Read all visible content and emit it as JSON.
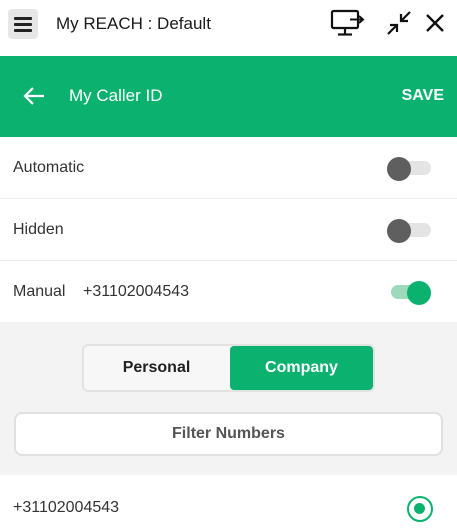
{
  "titlebar": {
    "title": "My REACH : Default",
    "icons": [
      "menu-icon",
      "screen-share-icon",
      "collapse-icon",
      "close-icon"
    ]
  },
  "header": {
    "title": "My Caller ID",
    "save_label": "SAVE",
    "back_icon": "arrow-left-icon"
  },
  "options": [
    {
      "label": "Automatic",
      "enabled": false
    },
    {
      "label": "Hidden",
      "enabled": false
    },
    {
      "label": "Manual",
      "number": "+31102004543",
      "enabled": true
    }
  ],
  "segment": {
    "personal_label": "Personal",
    "company_label": "Company",
    "selected": "Company"
  },
  "filter": {
    "label": "Filter Numbers"
  },
  "numbers": [
    {
      "value": "+31102004543",
      "selected": true
    }
  ],
  "colors": {
    "accent": "#0bb26f",
    "toggle_off_knob": "#5f5f5f",
    "panel_background": "#f3f3f3"
  }
}
